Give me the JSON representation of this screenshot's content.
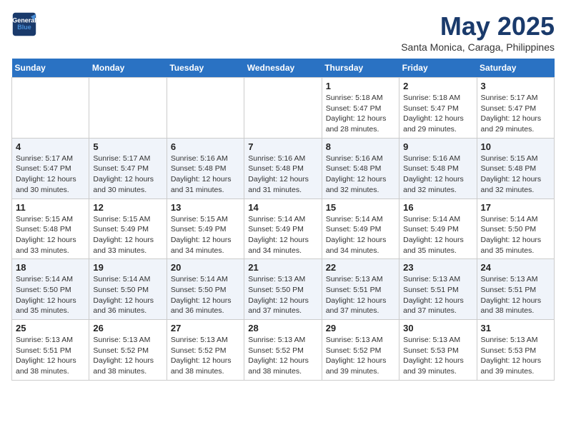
{
  "header": {
    "logo_line1": "General",
    "logo_line2": "Blue",
    "month": "May 2025",
    "location": "Santa Monica, Caraga, Philippines"
  },
  "days_of_week": [
    "Sunday",
    "Monday",
    "Tuesday",
    "Wednesday",
    "Thursday",
    "Friday",
    "Saturday"
  ],
  "weeks": [
    [
      {
        "day": "",
        "empty": true
      },
      {
        "day": "",
        "empty": true
      },
      {
        "day": "",
        "empty": true
      },
      {
        "day": "",
        "empty": true
      },
      {
        "day": "1",
        "sunrise": "5:18 AM",
        "sunset": "5:47 PM",
        "daylight": "12 hours and 28 minutes."
      },
      {
        "day": "2",
        "sunrise": "5:18 AM",
        "sunset": "5:47 PM",
        "daylight": "12 hours and 29 minutes."
      },
      {
        "day": "3",
        "sunrise": "5:17 AM",
        "sunset": "5:47 PM",
        "daylight": "12 hours and 29 minutes."
      }
    ],
    [
      {
        "day": "4",
        "sunrise": "5:17 AM",
        "sunset": "5:47 PM",
        "daylight": "12 hours and 30 minutes."
      },
      {
        "day": "5",
        "sunrise": "5:17 AM",
        "sunset": "5:47 PM",
        "daylight": "12 hours and 30 minutes."
      },
      {
        "day": "6",
        "sunrise": "5:16 AM",
        "sunset": "5:48 PM",
        "daylight": "12 hours and 31 minutes."
      },
      {
        "day": "7",
        "sunrise": "5:16 AM",
        "sunset": "5:48 PM",
        "daylight": "12 hours and 31 minutes."
      },
      {
        "day": "8",
        "sunrise": "5:16 AM",
        "sunset": "5:48 PM",
        "daylight": "12 hours and 32 minutes."
      },
      {
        "day": "9",
        "sunrise": "5:16 AM",
        "sunset": "5:48 PM",
        "daylight": "12 hours and 32 minutes."
      },
      {
        "day": "10",
        "sunrise": "5:15 AM",
        "sunset": "5:48 PM",
        "daylight": "12 hours and 32 minutes."
      }
    ],
    [
      {
        "day": "11",
        "sunrise": "5:15 AM",
        "sunset": "5:48 PM",
        "daylight": "12 hours and 33 minutes."
      },
      {
        "day": "12",
        "sunrise": "5:15 AM",
        "sunset": "5:49 PM",
        "daylight": "12 hours and 33 minutes."
      },
      {
        "day": "13",
        "sunrise": "5:15 AM",
        "sunset": "5:49 PM",
        "daylight": "12 hours and 34 minutes."
      },
      {
        "day": "14",
        "sunrise": "5:14 AM",
        "sunset": "5:49 PM",
        "daylight": "12 hours and 34 minutes."
      },
      {
        "day": "15",
        "sunrise": "5:14 AM",
        "sunset": "5:49 PM",
        "daylight": "12 hours and 34 minutes."
      },
      {
        "day": "16",
        "sunrise": "5:14 AM",
        "sunset": "5:49 PM",
        "daylight": "12 hours and 35 minutes."
      },
      {
        "day": "17",
        "sunrise": "5:14 AM",
        "sunset": "5:50 PM",
        "daylight": "12 hours and 35 minutes."
      }
    ],
    [
      {
        "day": "18",
        "sunrise": "5:14 AM",
        "sunset": "5:50 PM",
        "daylight": "12 hours and 35 minutes."
      },
      {
        "day": "19",
        "sunrise": "5:14 AM",
        "sunset": "5:50 PM",
        "daylight": "12 hours and 36 minutes."
      },
      {
        "day": "20",
        "sunrise": "5:14 AM",
        "sunset": "5:50 PM",
        "daylight": "12 hours and 36 minutes."
      },
      {
        "day": "21",
        "sunrise": "5:13 AM",
        "sunset": "5:50 PM",
        "daylight": "12 hours and 37 minutes."
      },
      {
        "day": "22",
        "sunrise": "5:13 AM",
        "sunset": "5:51 PM",
        "daylight": "12 hours and 37 minutes."
      },
      {
        "day": "23",
        "sunrise": "5:13 AM",
        "sunset": "5:51 PM",
        "daylight": "12 hours and 37 minutes."
      },
      {
        "day": "24",
        "sunrise": "5:13 AM",
        "sunset": "5:51 PM",
        "daylight": "12 hours and 38 minutes."
      }
    ],
    [
      {
        "day": "25",
        "sunrise": "5:13 AM",
        "sunset": "5:51 PM",
        "daylight": "12 hours and 38 minutes."
      },
      {
        "day": "26",
        "sunrise": "5:13 AM",
        "sunset": "5:52 PM",
        "daylight": "12 hours and 38 minutes."
      },
      {
        "day": "27",
        "sunrise": "5:13 AM",
        "sunset": "5:52 PM",
        "daylight": "12 hours and 38 minutes."
      },
      {
        "day": "28",
        "sunrise": "5:13 AM",
        "sunset": "5:52 PM",
        "daylight": "12 hours and 38 minutes."
      },
      {
        "day": "29",
        "sunrise": "5:13 AM",
        "sunset": "5:52 PM",
        "daylight": "12 hours and 39 minutes."
      },
      {
        "day": "30",
        "sunrise": "5:13 AM",
        "sunset": "5:53 PM",
        "daylight": "12 hours and 39 minutes."
      },
      {
        "day": "31",
        "sunrise": "5:13 AM",
        "sunset": "5:53 PM",
        "daylight": "12 hours and 39 minutes."
      }
    ]
  ]
}
